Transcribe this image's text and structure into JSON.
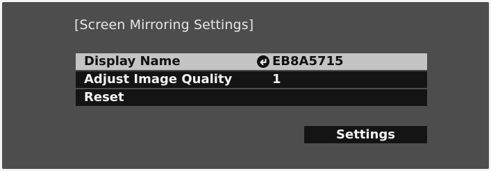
{
  "title": "[Screen Mirroring Settings]",
  "menu": {
    "items": [
      {
        "label": "Display Name",
        "value": "EB8A5715",
        "selected": true
      },
      {
        "label": "Adjust Image Quality",
        "value": "1",
        "selected": false
      },
      {
        "label": "Reset",
        "value": "",
        "selected": false
      }
    ]
  },
  "settings_button": {
    "label": "Settings"
  },
  "icons": {
    "display_name_value": "enter-icon"
  },
  "colors": {
    "screen_bg": "#4d4d4d",
    "row_bg": "#141414",
    "selected_row_bg": "#c4c4c4",
    "text_light": "#f2f2f2",
    "text_dark": "#111111"
  }
}
